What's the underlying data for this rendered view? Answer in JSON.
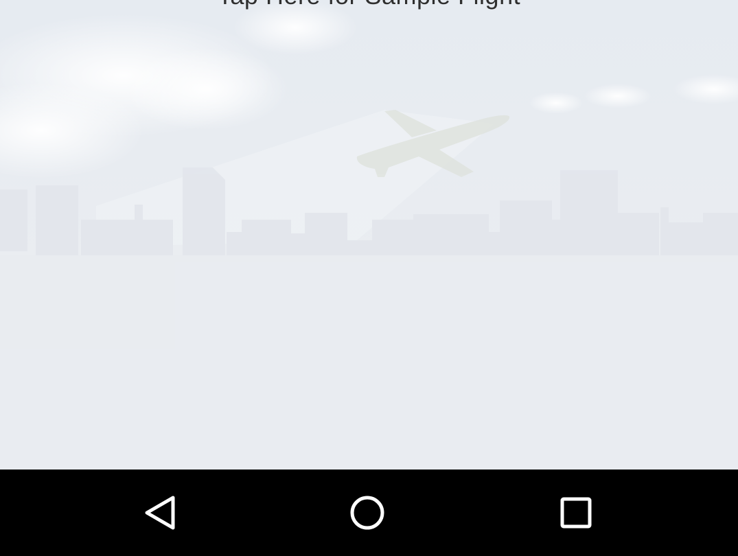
{
  "main": {
    "sample_flight_label": "Tap Here for Sample Flight",
    "background": {
      "sky_color": "#e9ecf0",
      "cloud_color": "#ffffff",
      "skyline_color": "#e4e7ec",
      "plane_color": "#e1e5e1"
    }
  },
  "navbar": {
    "background": "#000000",
    "icon_color": "#ffffff",
    "buttons": [
      {
        "name": "back",
        "icon": "back-triangle-icon"
      },
      {
        "name": "home",
        "icon": "home-circle-icon"
      },
      {
        "name": "recents",
        "icon": "recents-square-icon"
      }
    ]
  }
}
